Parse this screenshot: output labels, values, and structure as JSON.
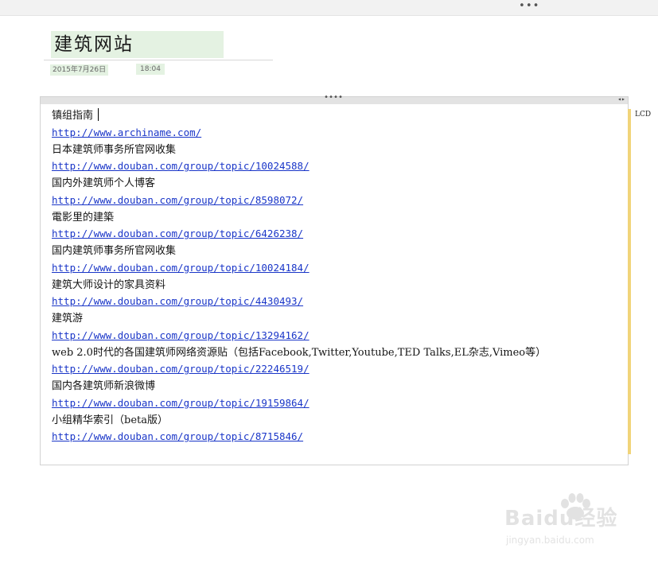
{
  "toolbar": {
    "more_glyph": "•••"
  },
  "page": {
    "title": "建筑网站",
    "date": "2015年7月26日",
    "time": "18:04"
  },
  "note": {
    "handle_glyph": "••••",
    "resize_glyph": "◂▸",
    "side_label": "LCD",
    "accent_color": "#f1d47a",
    "link_color": "#1a36c8",
    "lines": [
      {
        "kind": "text",
        "text": "镇组指南"
      },
      {
        "kind": "link",
        "text": "http://www.archiname.com/"
      },
      {
        "kind": "text",
        "text": "日本建筑师事务所官网收集"
      },
      {
        "kind": "link",
        "text": "http://www.douban.com/group/topic/10024588/"
      },
      {
        "kind": "text",
        "text": "国内外建筑师个人博客"
      },
      {
        "kind": "link",
        "text": "http://www.douban.com/group/topic/8598072/"
      },
      {
        "kind": "text",
        "text": "電影里的建築"
      },
      {
        "kind": "link",
        "text": "http://www.douban.com/group/topic/6426238/"
      },
      {
        "kind": "text",
        "text": "国内建筑师事务所官网收集"
      },
      {
        "kind": "link",
        "text": "http://www.douban.com/group/topic/10024184/"
      },
      {
        "kind": "text",
        "text": "建筑大师设计的家具资料"
      },
      {
        "kind": "link",
        "text": "http://www.douban.com/group/topic/4430493/"
      },
      {
        "kind": "text",
        "text": "建筑游"
      },
      {
        "kind": "link",
        "text": "http://www.douban.com/group/topic/13294162/"
      },
      {
        "kind": "text",
        "text": "web 2.0时代的各国建筑师网络资源贴（包括Facebook,Twitter,Youtube,TED Talks,EL杂志,Vimeo等）"
      },
      {
        "kind": "link",
        "text": "http://www.douban.com/group/topic/22246519/"
      },
      {
        "kind": "text",
        "text": "国内各建筑师新浪微博"
      },
      {
        "kind": "link",
        "text": "http://www.douban.com/group/topic/19159864/"
      },
      {
        "kind": "text",
        "text": "小组精华索引（beta版）"
      },
      {
        "kind": "link",
        "text": "http://www.douban.com/group/topic/8715846/"
      }
    ]
  },
  "watermark": {
    "brand": "Baidu经验",
    "site": "jingyan.baidu.com",
    "icon": "paw-icon"
  }
}
